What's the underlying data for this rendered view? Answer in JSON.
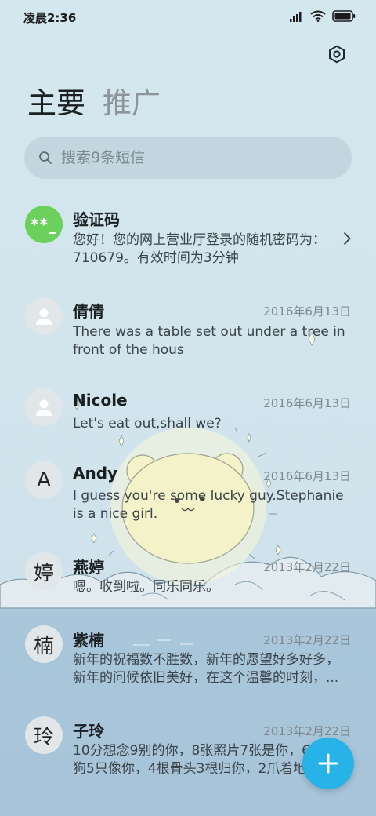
{
  "status_bar": {
    "time": "凌晨2:36"
  },
  "header": {
    "settings_icon": "gear-hexagon-icon",
    "tabs": [
      {
        "label": "主要",
        "active": true
      },
      {
        "label": "推广",
        "active": false
      }
    ]
  },
  "search": {
    "placeholder": "搜索9条短信",
    "value": ""
  },
  "messages": [
    {
      "avatar": "**_",
      "avatar_color": "#6cd05c",
      "name": "验证码",
      "date": "",
      "preview": "您好！您的网上营业厅登录的随机密码为：710679。有效时间为3分钟"
    },
    {
      "avatar": "person-icon",
      "name": "倩倩",
      "date": "2016年6月13日",
      "preview": "There was a table set out under a tree in front of the hous"
    },
    {
      "avatar": "person-icon",
      "name": "Nicole",
      "date": "2016年6月13日",
      "preview": "Let's eat out,shall we?"
    },
    {
      "avatar": "A",
      "name": "Andy",
      "date": "2016年6月13日",
      "preview": "I guess you're some lucky guy.Stephanie is a nice girl."
    },
    {
      "avatar": "婷",
      "name": "燕婷",
      "date": "2013年2月22日",
      "preview": "嗯。收到啦。同乐同乐。"
    },
    {
      "avatar": "楠",
      "name": "紫楠",
      "date": "2013年2月22日",
      "preview": "新年的祝福数不胜数，新年的愿望好多好多，新年的问候依旧美好，在这个温馨的时刻，..."
    },
    {
      "avatar": "玲",
      "name": "子玲",
      "date": "2013年2月22日",
      "preview": "10分想念9别的你，8张照片7张是你，6只小狗5只像你，4根骨头3根归你，2爪着地"
    }
  ],
  "fab": {
    "icon": "plus-icon",
    "color": "#27b2e8"
  }
}
